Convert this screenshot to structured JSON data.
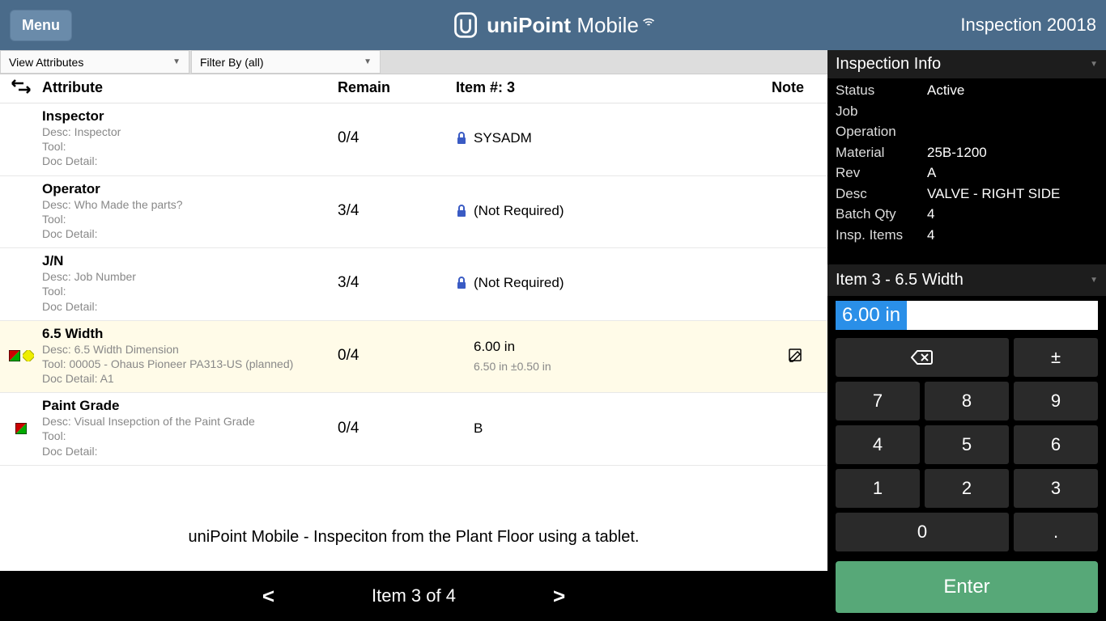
{
  "header": {
    "menu_label": "Menu",
    "brand_main": "uniPoint",
    "brand_sub": "Mobile",
    "inspection_label": "Inspection 20018"
  },
  "filters": {
    "view_attributes": "View Attributes",
    "filter_by": "Filter By (all)"
  },
  "columns": {
    "attribute": "Attribute",
    "remain": "Remain",
    "item": "Item #: 3",
    "note": "Note"
  },
  "rows": [
    {
      "name": "Inspector",
      "desc": "Desc: Inspector",
      "tool": "Tool:",
      "doc": "Doc Detail:",
      "remain": "0/4",
      "locked": true,
      "value": "SYSADM",
      "tol": "",
      "flags": [],
      "selected": false,
      "note_edit": false
    },
    {
      "name": "Operator",
      "desc": "Desc: Who Made the parts?",
      "tool": "Tool:",
      "doc": "Doc Detail:",
      "remain": "3/4",
      "locked": true,
      "value": "(Not Required)",
      "tol": "",
      "flags": [],
      "selected": false,
      "note_edit": false
    },
    {
      "name": "J/N",
      "desc": "Desc: Job Number",
      "tool": "Tool:",
      "doc": "Doc Detail:",
      "remain": "3/4",
      "locked": true,
      "value": "(Not Required)",
      "tol": "",
      "flags": [],
      "selected": false,
      "note_edit": false
    },
    {
      "name": "6.5 Width",
      "desc": "Desc: 6.5 Width Dimension",
      "tool": "Tool: 00005 - Ohaus Pioneer PA313-US (planned)",
      "doc": "Doc Detail: A1",
      "remain": "0/4",
      "locked": false,
      "value": "6.00 in",
      "tol": "6.50 in ±0.50 in",
      "flags": [
        "redgreen",
        "yellow"
      ],
      "selected": true,
      "note_edit": true
    },
    {
      "name": "Paint Grade",
      "desc": "Desc: Visual Insepction of the Paint Grade",
      "tool": "Tool:",
      "doc": "Doc Detail:",
      "remain": "0/4",
      "locked": false,
      "value": "B",
      "tol": "",
      "flags": [
        "redgreen"
      ],
      "selected": false,
      "note_edit": false
    }
  ],
  "caption": "uniPoint Mobile - Inspeciton from the Plant Floor using a tablet.",
  "footer": {
    "prev": "<",
    "pager": "Item 3 of 4",
    "next": ">"
  },
  "info": {
    "title": "Inspection Info",
    "rows": [
      {
        "lbl": "Status",
        "val": "Active"
      },
      {
        "lbl": "Job",
        "val": ""
      },
      {
        "lbl": "Operation",
        "val": ""
      },
      {
        "lbl": "Material",
        "val": "25B-1200"
      },
      {
        "lbl": "Rev",
        "val": "A"
      },
      {
        "lbl": "Desc",
        "val": "VALVE -  RIGHT SIDE"
      },
      {
        "lbl": "Batch Qty",
        "val": "4"
      },
      {
        "lbl": "Insp. Items",
        "val": "4"
      }
    ]
  },
  "item_panel": {
    "title": "Item 3 - 6.5 Width",
    "value": "6.00 in"
  },
  "keypad": {
    "backspace": "⌫",
    "pm": "±",
    "k7": "7",
    "k8": "8",
    "k9": "9",
    "k4": "4",
    "k5": "5",
    "k6": "6",
    "k1": "1",
    "k2": "2",
    "k3": "3",
    "k0": "0",
    "dot": ".",
    "enter": "Enter"
  }
}
